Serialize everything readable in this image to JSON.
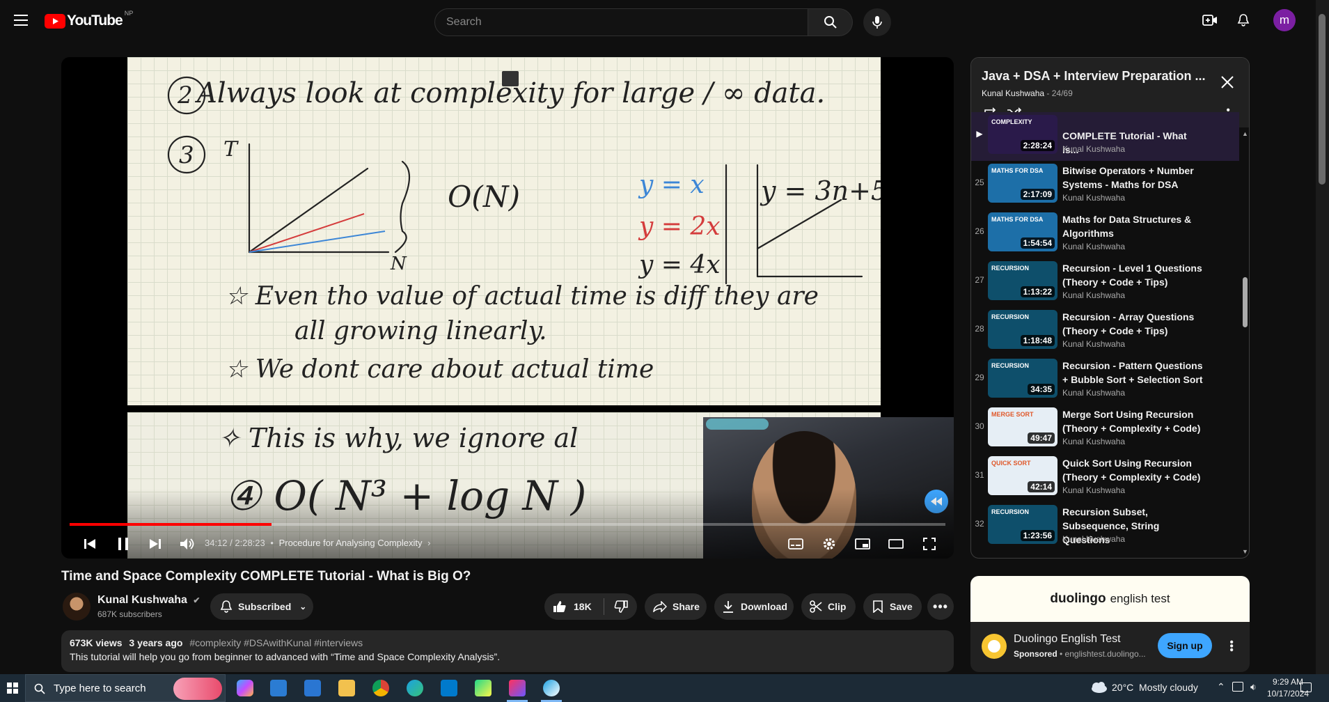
{
  "topbar": {
    "logo_text": "YouTube",
    "region": "NP",
    "search_placeholder": "Search",
    "avatar_letter": "m"
  },
  "player": {
    "time": "34:12 / 2:28:23",
    "chapter_separator": "•",
    "chapter": "Procedure for Analysing Complexity",
    "progress": 0.2302
  },
  "video": {
    "title": "Time and Space Complexity COMPLETE Tutorial - What is Big O?",
    "channel": "Kunal Kushwaha",
    "subscribers": "687K subscribers",
    "subscribed_label": "Subscribed",
    "likes": "18K",
    "share_label": "Share",
    "download_label": "Download",
    "clip_label": "Clip",
    "save_label": "Save"
  },
  "description": {
    "views": "673K views",
    "age": "3 years ago",
    "tags": "#complexity #DSAwithKunal #interviews",
    "text": "This tutorial will help you go from beginner to advanced with “Time and Space Complexity Analysis”."
  },
  "playlist": {
    "title": "Java + DSA + Interview Preparation ...",
    "owner": "Kunal Kushwaha",
    "position": "24/69",
    "items": [
      {
        "num": "▶",
        "title": "COMPLETE Tutorial - What is...",
        "channel": "Kunal Kushwaha",
        "duration": "2:28:24",
        "thumb_label": "COMPLEXITY",
        "thumb_color": "#2a1a4a"
      },
      {
        "num": "25",
        "title": "Bitwise Operators + Number Systems - Maths for DSA",
        "channel": "Kunal Kushwaha",
        "duration": "2:17:09",
        "thumb_label": "MATHS FOR DSA",
        "thumb_color": "#1d6fa8"
      },
      {
        "num": "26",
        "title": "Maths for Data Structures & Algorithms",
        "channel": "Kunal Kushwaha",
        "duration": "1:54:54",
        "thumb_label": "MATHS FOR DSA",
        "thumb_color": "#1d6fa8"
      },
      {
        "num": "27",
        "title": "Recursion - Level 1 Questions (Theory + Code + Tips)",
        "channel": "Kunal Kushwaha",
        "duration": "1:13:22",
        "thumb_label": "RECURSION",
        "thumb_color": "#0e4f6b"
      },
      {
        "num": "28",
        "title": "Recursion - Array Questions (Theory + Code + Tips)",
        "channel": "Kunal Kushwaha",
        "duration": "1:18:48",
        "thumb_label": "RECURSION",
        "thumb_color": "#0e4f6b"
      },
      {
        "num": "29",
        "title": "Recursion - Pattern Questions + Bubble Sort + Selection Sort",
        "channel": "Kunal Kushwaha",
        "duration": "34:35",
        "thumb_label": "RECURSION",
        "thumb_color": "#0e4f6b"
      },
      {
        "num": "30",
        "title": "Merge Sort Using Recursion (Theory + Complexity + Code)",
        "channel": "Kunal Kushwaha",
        "duration": "49:47",
        "thumb_label": "MERGE SORT",
        "thumb_color": "#e6eef5"
      },
      {
        "num": "31",
        "title": "Quick Sort Using Recursion (Theory + Complexity + Code)",
        "channel": "Kunal Kushwaha",
        "duration": "42:14",
        "thumb_label": "QUICK SORT",
        "thumb_color": "#e6eef5"
      },
      {
        "num": "32",
        "title": "Recursion Subset, Subsequence, String Questions",
        "channel": "Kunal Kushwaha",
        "duration": "1:23:56",
        "thumb_label": "RECURSION",
        "thumb_color": "#0e4f6b"
      }
    ]
  },
  "ad": {
    "banner_brand": "duolingo",
    "banner_suffix": "english test",
    "name": "Duolingo English Test",
    "sponsored": "Sponsored",
    "domain": "englishtest.duolingo...",
    "cta": "Sign up"
  },
  "taskbar": {
    "search_placeholder": "Type here to search",
    "weather": "20°C  Mostly cloudy",
    "time": "9:29 AM",
    "date": "10/17/2024"
  }
}
